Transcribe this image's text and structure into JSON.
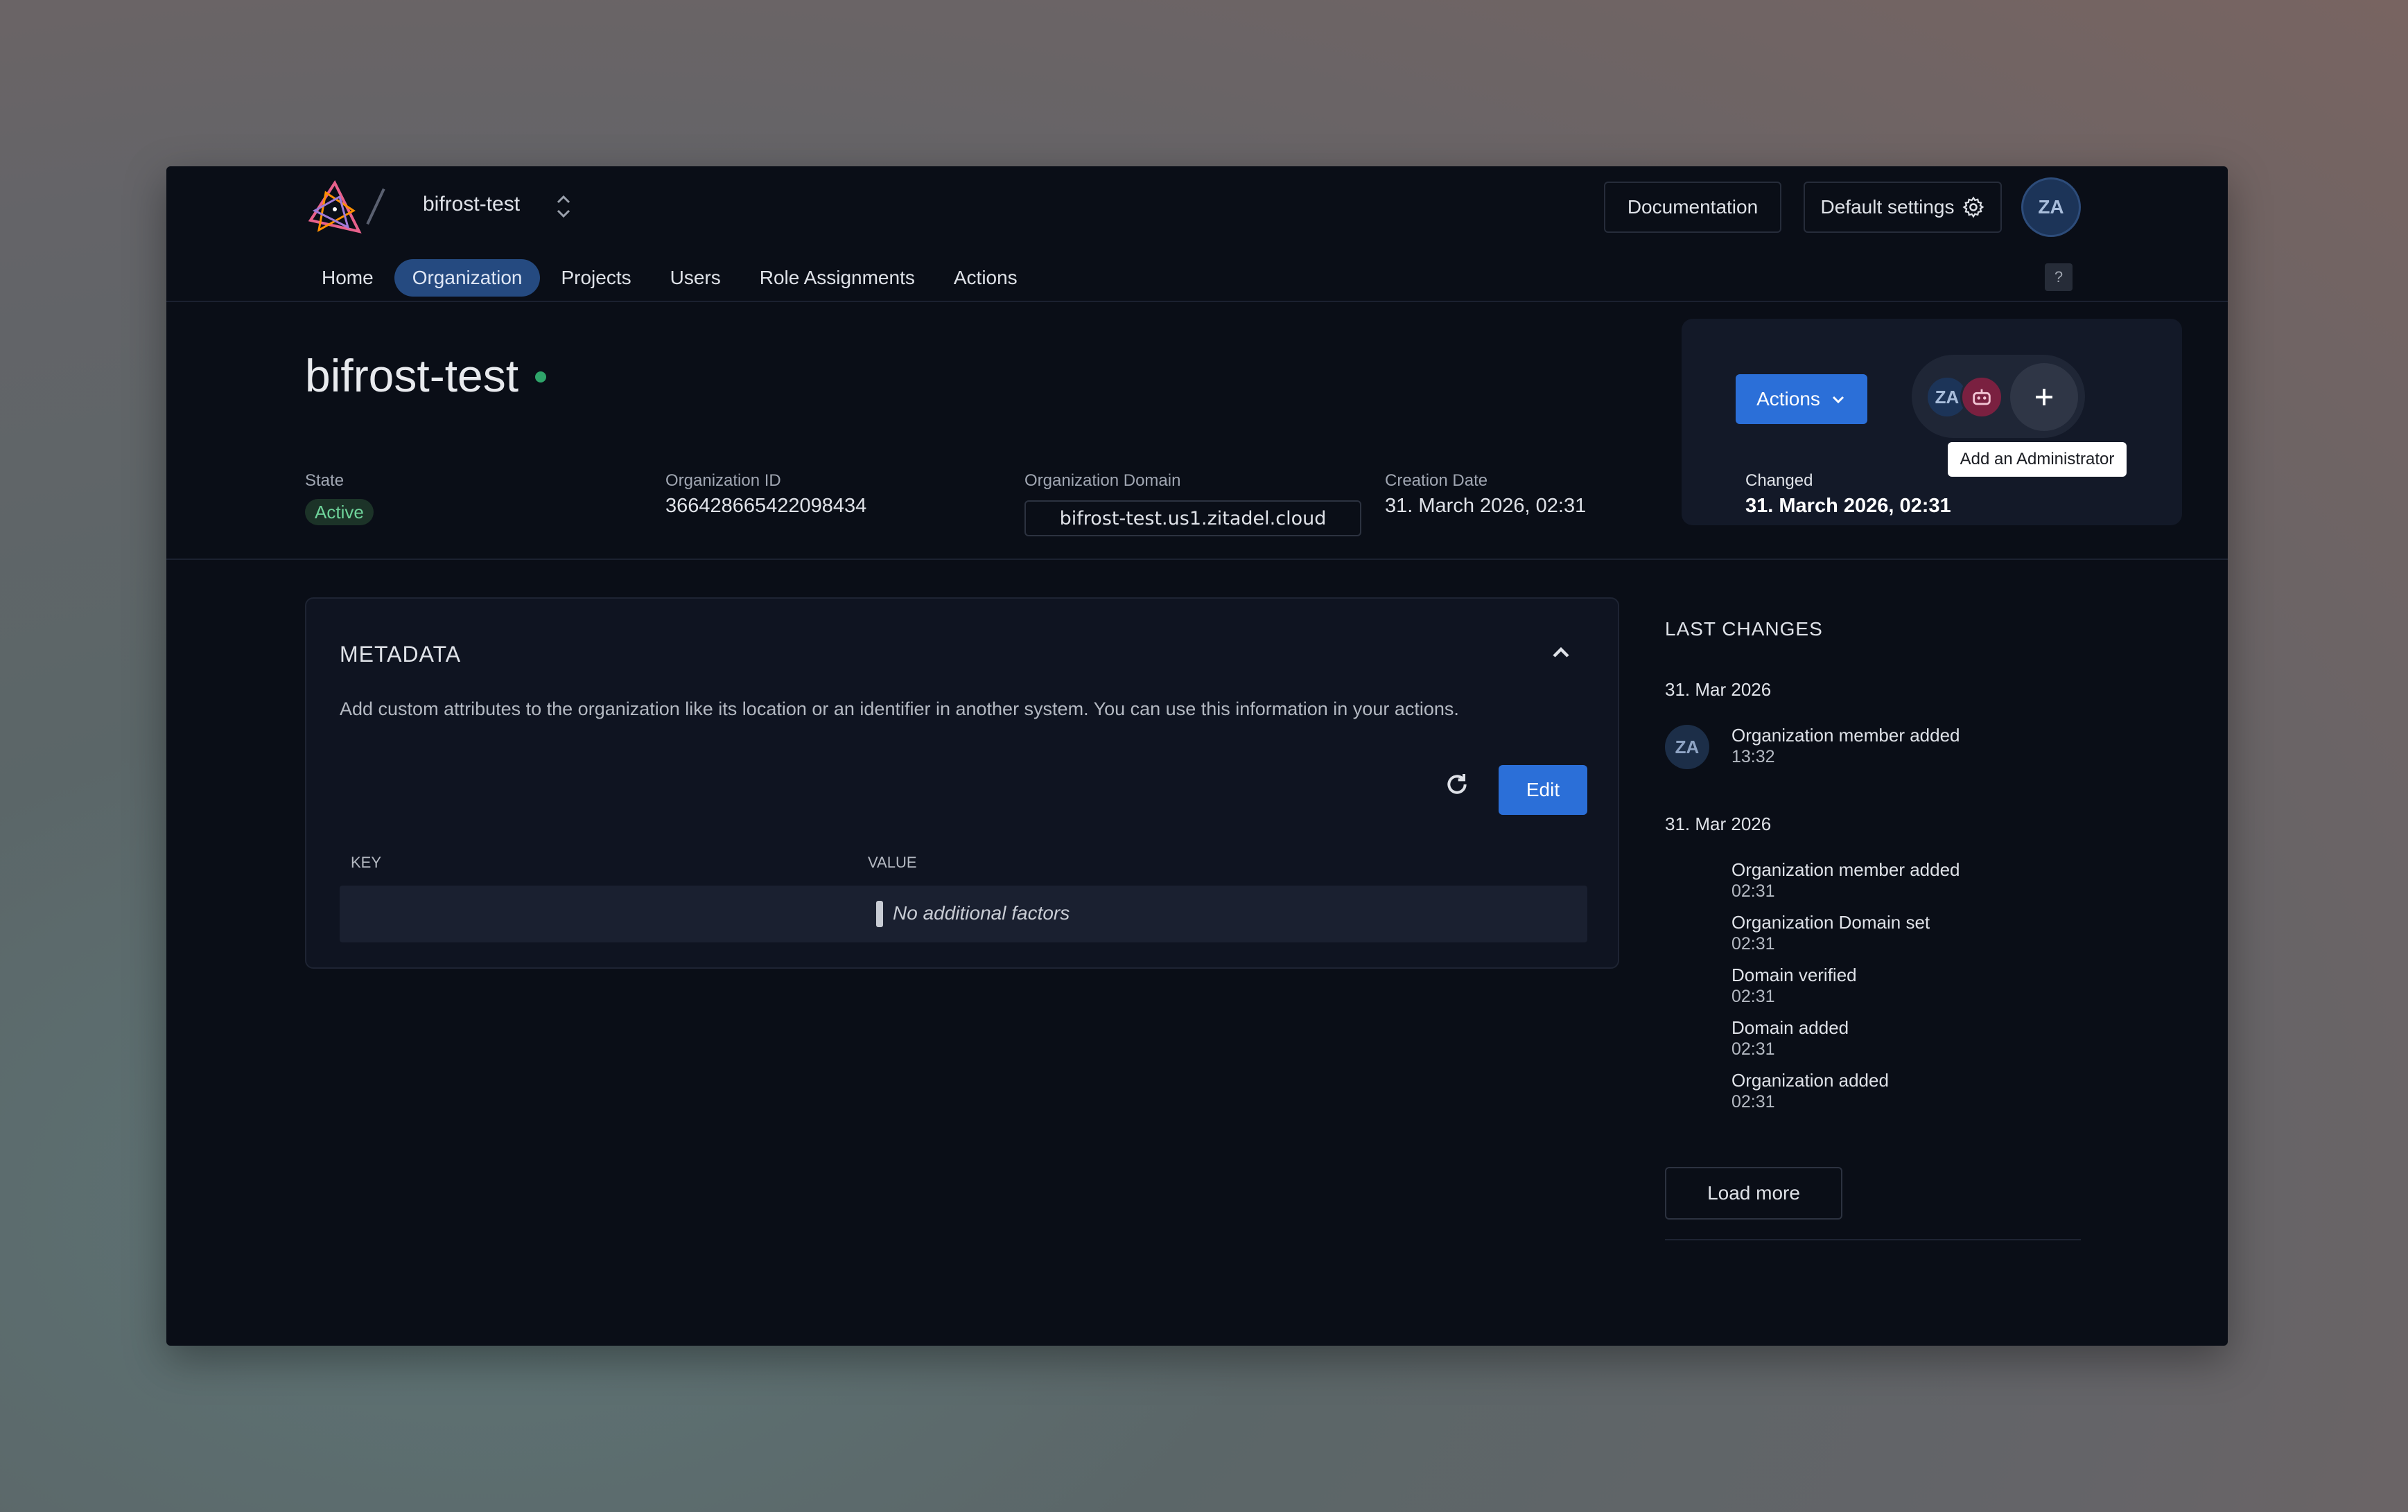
{
  "header": {
    "org_name": "bifrost-test",
    "documentation_label": "Documentation",
    "default_settings_label": "Default settings",
    "user_initials": "ZA",
    "help_label": "?"
  },
  "nav": {
    "items": [
      "Home",
      "Organization",
      "Projects",
      "Users",
      "Role Assignments",
      "Actions"
    ],
    "active": "Organization"
  },
  "org": {
    "title": "bifrost-test",
    "state_label": "State",
    "state_value": "Active",
    "id_label": "Organization ID",
    "id_value": "366428665422098434",
    "domain_label": "Organization Domain",
    "domain_value": "bifrost-test.us1.zitadel.cloud",
    "creation_label": "Creation Date",
    "creation_value": "31. March 2026, 02:31"
  },
  "action_card": {
    "actions_label": "Actions",
    "admin_initials": "ZA",
    "tooltip": "Add an Administrator",
    "changed_label": "Changed",
    "changed_value": "31. March 2026, 02:31"
  },
  "metadata": {
    "title": "METADATA",
    "description": "Add custom attributes to the organization like its location or an identifier in another system. You can use this information in your actions.",
    "edit_label": "Edit",
    "columns": [
      "KEY",
      "VALUE"
    ],
    "empty_text": "No additional factors"
  },
  "last_changes": {
    "title": "LAST CHANGES",
    "groups": [
      {
        "date": "31. Mar 2026",
        "avatar": "ZA",
        "events": [
          {
            "name": "Organization member added",
            "time": "13:32"
          }
        ]
      },
      {
        "date": "31. Mar 2026",
        "events": [
          {
            "name": "Organization member added",
            "time": "02:31"
          },
          {
            "name": "Organization Domain set",
            "time": "02:31"
          },
          {
            "name": "Domain verified",
            "time": "02:31"
          },
          {
            "name": "Domain added",
            "time": "02:31"
          },
          {
            "name": "Organization added",
            "time": "02:31"
          }
        ]
      }
    ],
    "load_more_label": "Load more"
  },
  "colors": {
    "accent": "#2b6fd8",
    "active_nav": "#254a80",
    "status_active": "#2fa46a",
    "background": "#0a0e17"
  }
}
